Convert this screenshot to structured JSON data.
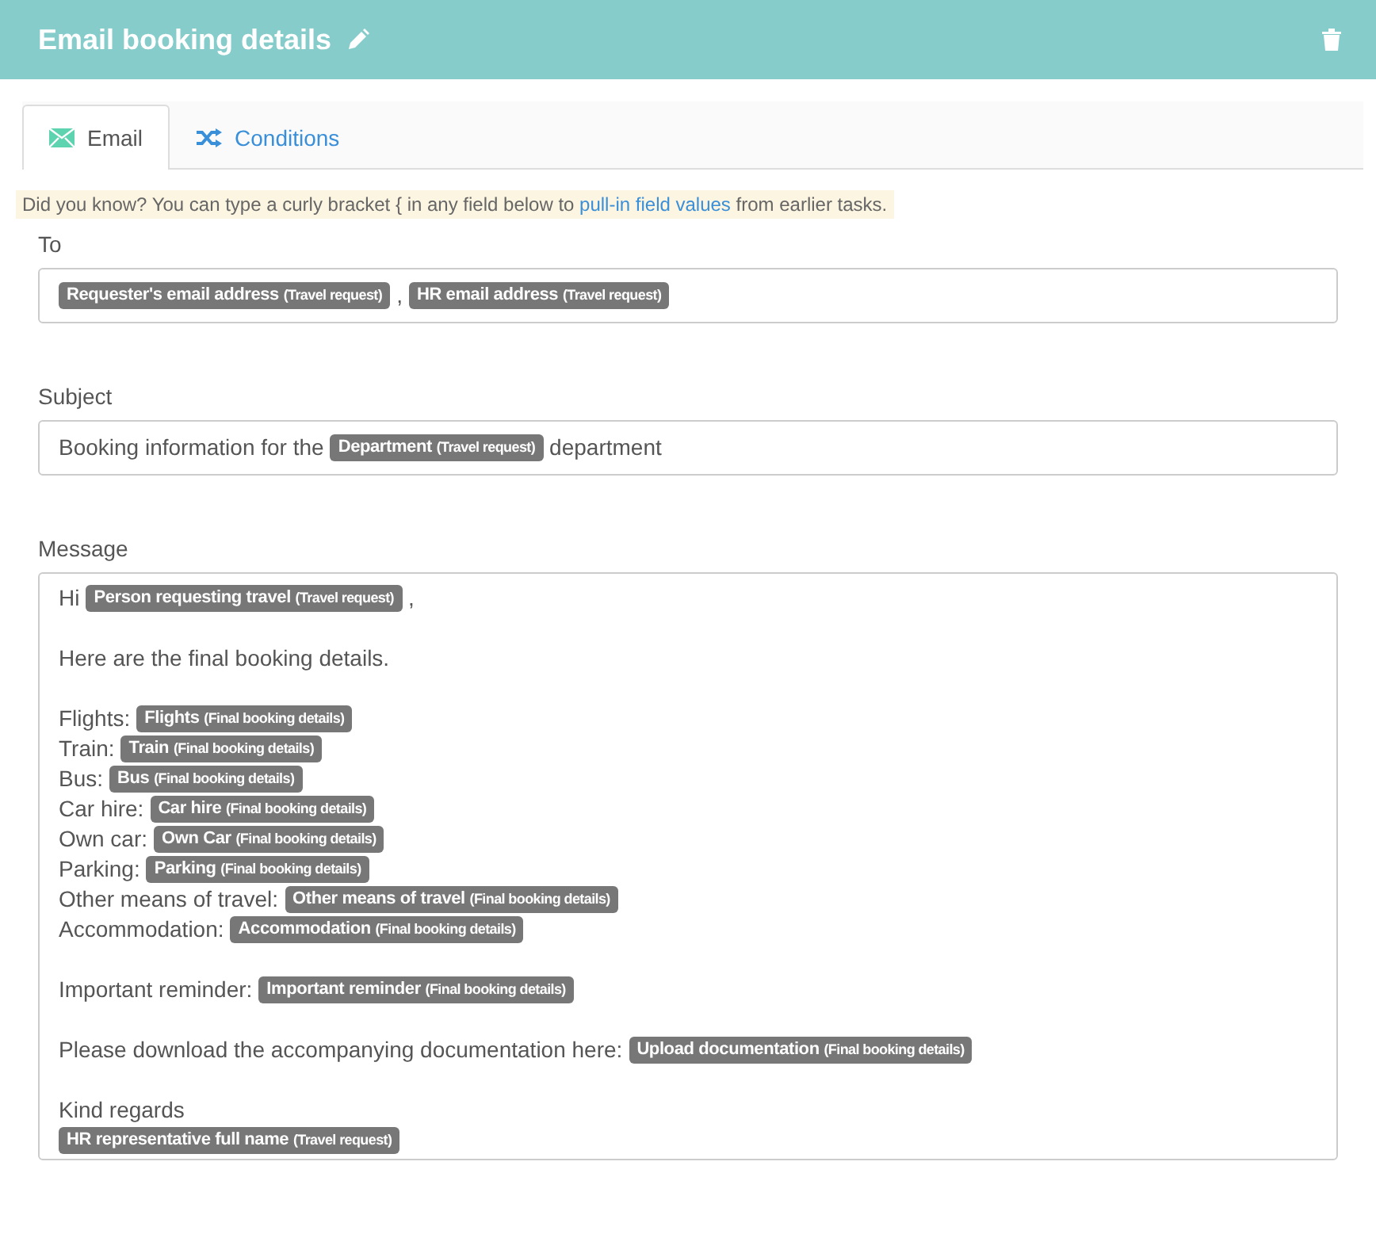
{
  "header": {
    "title": "Email booking details"
  },
  "tabs": [
    {
      "label": "Email",
      "kind": "email",
      "selected": true
    },
    {
      "label": "Conditions",
      "kind": "shuffle",
      "selected": false
    }
  ],
  "hint": {
    "before": "Did you know? You can type a curly bracket { in any field below to ",
    "link": "pull-in field values",
    "after": " from earlier tasks."
  },
  "fields": [
    {
      "label": "To",
      "kind": "line",
      "lines": [
        [
          {
            "kind": "token",
            "field": "Requester's email address",
            "source": "(Travel request)"
          },
          {
            "kind": "text",
            "text": ","
          },
          {
            "kind": "token",
            "field": "HR email address",
            "source": "(Travel request)"
          }
        ]
      ]
    },
    {
      "label": "Subject",
      "kind": "line",
      "lines": [
        [
          {
            "kind": "text",
            "text": "Booking information for the"
          },
          {
            "kind": "token",
            "field": "Department",
            "source": "(Travel request)"
          },
          {
            "kind": "text",
            "text": "department"
          }
        ]
      ]
    },
    {
      "label": "Message",
      "kind": "multi",
      "paragraphs": [
        {
          "lines": [
            [
              {
                "kind": "text",
                "text": "Hi"
              },
              {
                "kind": "token",
                "field": "Person requesting travel",
                "source": "(Travel request)"
              },
              {
                "kind": "text",
                "text": ","
              }
            ]
          ]
        },
        {
          "lines": [
            [
              {
                "kind": "text",
                "text": "Here are the final booking details."
              }
            ]
          ]
        },
        {
          "lines": [
            [
              {
                "kind": "text",
                "text": "Flights:"
              },
              {
                "kind": "token",
                "field": "Flights",
                "source": "(Final booking details)"
              }
            ],
            [
              {
                "kind": "text",
                "text": "Train:"
              },
              {
                "kind": "token",
                "field": "Train",
                "source": "(Final booking details)"
              }
            ],
            [
              {
                "kind": "text",
                "text": "Bus:"
              },
              {
                "kind": "token",
                "field": "Bus",
                "source": "(Final booking details)"
              }
            ],
            [
              {
                "kind": "text",
                "text": "Car hire:"
              },
              {
                "kind": "token",
                "field": "Car hire",
                "source": "(Final booking details)"
              }
            ],
            [
              {
                "kind": "text",
                "text": "Own car:"
              },
              {
                "kind": "token",
                "field": "Own Car",
                "source": "(Final booking details)"
              }
            ],
            [
              {
                "kind": "text",
                "text": "Parking:"
              },
              {
                "kind": "token",
                "field": "Parking",
                "source": "(Final booking details)"
              }
            ],
            [
              {
                "kind": "text",
                "text": "Other means of travel:"
              },
              {
                "kind": "token",
                "field": "Other means of travel",
                "source": "(Final booking details)"
              }
            ],
            [
              {
                "kind": "text",
                "text": "Accommodation:"
              },
              {
                "kind": "token",
                "field": "Accommodation",
                "source": "(Final booking details)"
              }
            ]
          ]
        },
        {
          "lines": [
            [
              {
                "kind": "text",
                "text": "Important reminder:"
              },
              {
                "kind": "token",
                "field": "Important reminder",
                "source": "(Final booking details)"
              }
            ]
          ]
        },
        {
          "lines": [
            [
              {
                "kind": "text",
                "text": "Please download the accompanying documentation here:"
              },
              {
                "kind": "token",
                "field": "Upload documentation",
                "source": "(Final booking details)"
              }
            ]
          ]
        },
        {
          "lines": [
            [
              {
                "kind": "text",
                "text": "Kind regards"
              }
            ],
            [
              {
                "kind": "token",
                "field": "HR representative full name",
                "source": "(Travel request)"
              }
            ]
          ]
        }
      ]
    }
  ]
}
